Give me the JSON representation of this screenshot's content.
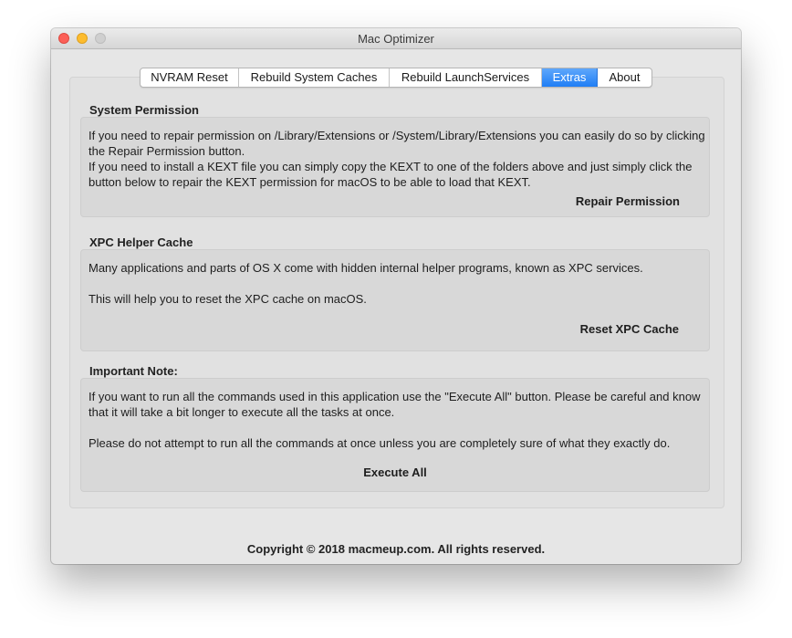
{
  "window": {
    "title": "Mac Optimizer"
  },
  "tabs": [
    {
      "label": "NVRAM Reset",
      "active": false
    },
    {
      "label": "Rebuild System Caches",
      "active": false
    },
    {
      "label": "Rebuild LaunchServices",
      "active": false
    },
    {
      "label": "Extras",
      "active": true
    },
    {
      "label": "About",
      "active": false
    }
  ],
  "colors": {
    "active_tab": "#1f7ef5",
    "close": "#fc5f57",
    "minimize": "#fdbc2e",
    "zoom_disabled": "#cfcfcf"
  },
  "system_permission": {
    "title": "System Permission",
    "text1": "If you need to repair permission on /Library/Extensions or /System/Library/Extensions you can easily do so by clicking the Repair Permission button.",
    "text2": "If you need to install a KEXT file you can simply copy the KEXT to one of the folders above and just simply click the button below to repair the KEXT permission for macOS to be able to load that KEXT.",
    "button": "Repair Permission"
  },
  "xpc_helper_cache": {
    "title": "XPC Helper Cache",
    "text1": "Many applications and parts of OS X come with hidden internal helper programs, known as XPC services.",
    "text2": "This will help you to reset the XPC cache on macOS.",
    "button": "Reset XPC Cache"
  },
  "important_note": {
    "title": "Important Note:",
    "text1": "If you want to run all the commands used in this application use the \"Execute All\" button. Please be careful and know that it will take a bit longer to execute all the tasks at once.",
    "text2": "Please do not attempt to run all the commands at once unless you are completely sure of what they exactly do.",
    "button": "Execute All"
  },
  "footer": {
    "copyright": "Copyright © 2018 macmeup.com. All rights reserved."
  }
}
